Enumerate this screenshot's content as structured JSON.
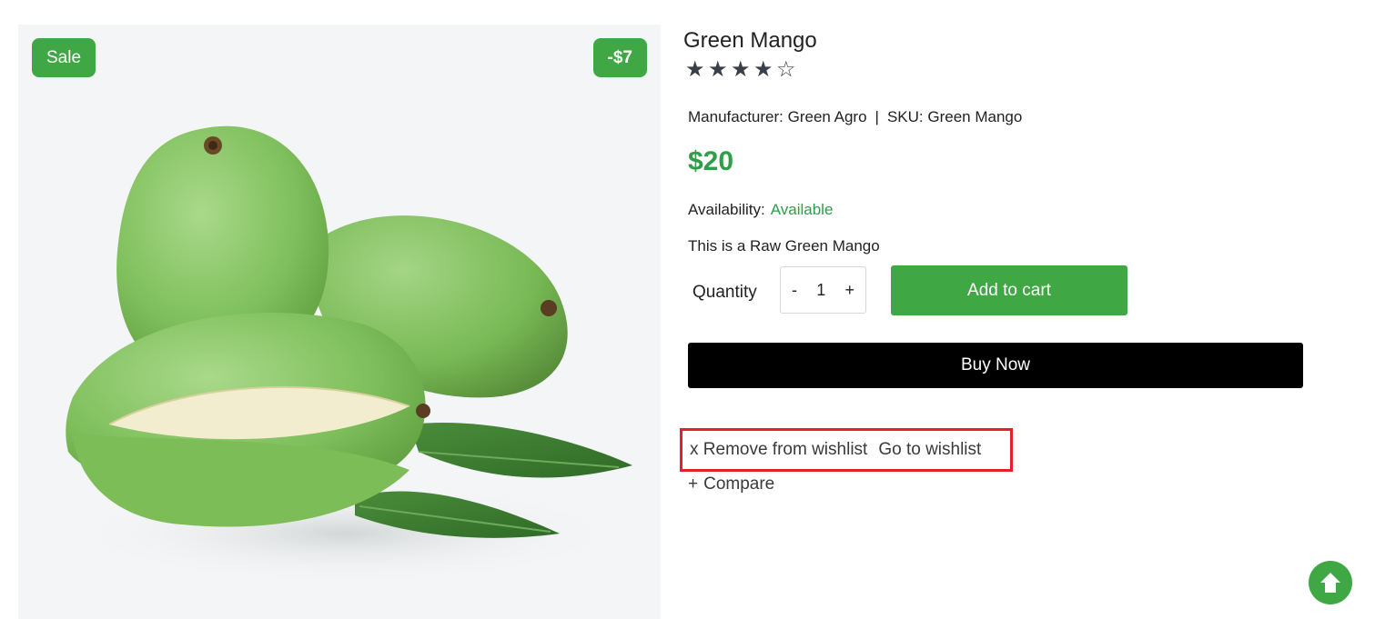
{
  "product": {
    "badge_sale": "Sale",
    "badge_discount": "-$7",
    "title": "Green Mango",
    "rating": 4,
    "rating_max": 5,
    "manufacturer_text": "Manufacturer: Green Agro",
    "sku_text": "SKU: Green Mango",
    "separator": "|",
    "price": "$20",
    "availability_label": "Availability:",
    "availability_status": "Available",
    "description": "This is a Raw Green Mango"
  },
  "cart": {
    "quantity_label": "Quantity",
    "decrement": "-",
    "quantity_value": "1",
    "increment": "+",
    "add_to_cart": "Add to cart",
    "buy_now": "Buy Now"
  },
  "wishlist": {
    "remove_label": "x Remove from wishlist",
    "goto_label": "Go to wishlist"
  },
  "compare": {
    "plus": "+",
    "label": "Compare"
  },
  "colors": {
    "accent_green": "#3fa845",
    "price_green": "#2f9e49",
    "highlight_red": "#e3202c"
  },
  "icons": {
    "scroll_top": "arrow-up-circle-icon"
  }
}
